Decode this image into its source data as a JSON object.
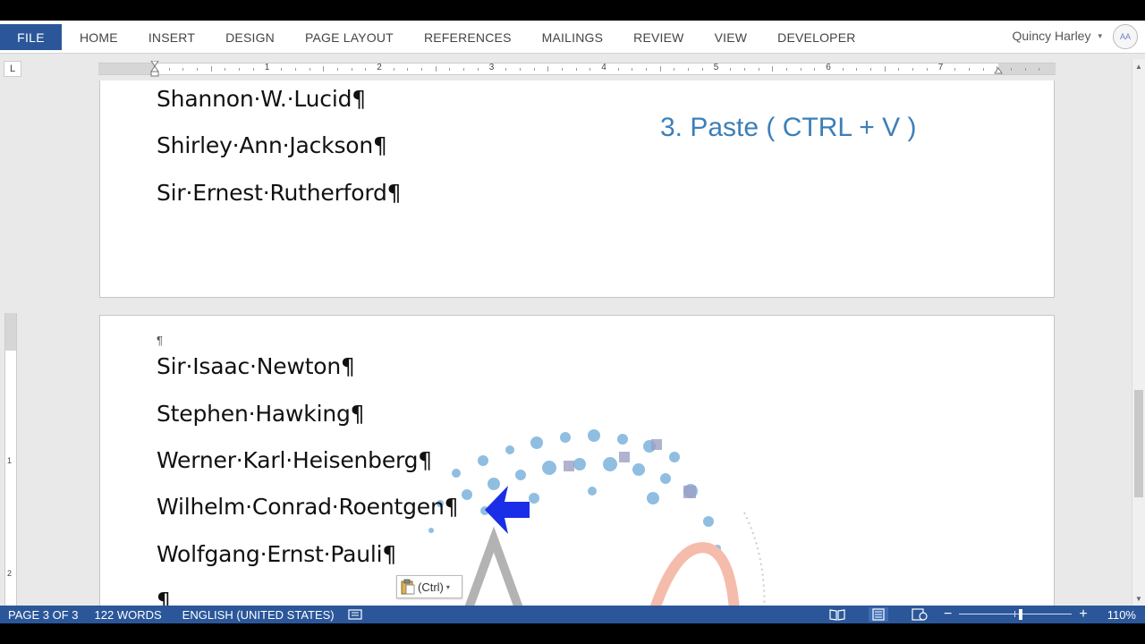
{
  "ribbon": {
    "file_tab": "FILE",
    "tabs": [
      "HOME",
      "INSERT",
      "DESIGN",
      "PAGE LAYOUT",
      "REFERENCES",
      "MAILINGS",
      "REVIEW",
      "VIEW",
      "DEVELOPER"
    ],
    "user_name": "Quincy Harley",
    "user_caret": "▾",
    "avatar_text": "AA"
  },
  "ruler": {
    "corner_glyph": "L",
    "numbers": [
      "1",
      "2",
      "3",
      "4",
      "5",
      "6",
      "7"
    ],
    "vertical_numbers": [
      "1",
      "2"
    ]
  },
  "page1": {
    "lines": [
      "Shannon·W.·Lucid¶",
      "Shirley·Ann·Jackson¶",
      "Sir·Ernest·Rutherford¶"
    ],
    "instruction": "3. Paste ( CTRL + V )"
  },
  "page2": {
    "pilcrow_small": "¶",
    "lines": [
      "Sir·Isaac·Newton¶",
      "Stephen·Hawking¶",
      "Werner·Karl·Heisenberg¶",
      "Wilhelm·Conrad·Roentgen¶",
      "Wolfgang·Ernst·Pauli¶",
      "¶"
    ],
    "paste_options_label": "(Ctrl)",
    "paste_options_caret": "▾"
  },
  "colors": {
    "accent": "#2b579a",
    "instruction_text": "#3c7fb8",
    "arrow": "#1a2ee8"
  },
  "statusbar": {
    "page": "PAGE 3 OF 3",
    "words": "122 WORDS",
    "language": "ENGLISH (UNITED STATES)",
    "zoom_minus": "−",
    "zoom_plus": "+",
    "zoom_level": "110%",
    "zoom_fraction": 0.55
  },
  "scrollbar": {
    "up_glyph": "▲",
    "down_glyph": "▼"
  }
}
